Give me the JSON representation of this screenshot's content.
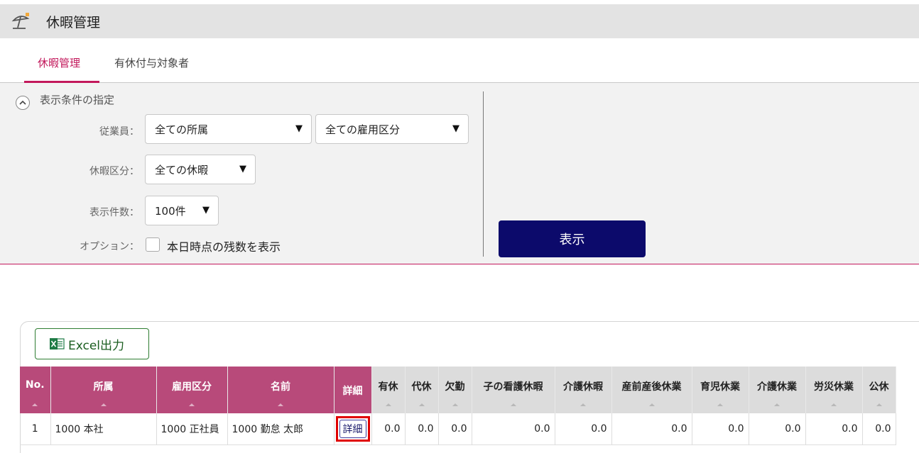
{
  "app": {
    "title": "休暇管理",
    "icon": "beach-umbrella-icon"
  },
  "tabs": [
    {
      "label": "休暇管理",
      "active": true
    },
    {
      "label": "有休付与対象者",
      "active": false
    }
  ],
  "filter": {
    "heading": "表示条件の指定",
    "employee_label": "従業員：",
    "department_select": "全ての所属",
    "employment_select": "全ての雇用区分",
    "leave_type_label": "休暇区分：",
    "leave_type_select": "全ての休暇",
    "page_size_label": "表示件数：",
    "page_size_select": "100件",
    "option_label": "オプション：",
    "option_checkbox_label": "本日時点の残数を表示",
    "option_checked": false,
    "show_button": "表示"
  },
  "results": {
    "excel_button": "Excel出力",
    "columns": [
      "No.",
      "所属",
      "雇用区分",
      "名前",
      "詳細",
      "有休",
      "代休",
      "欠勤",
      "子の看護休暇",
      "介護休暇",
      "産前産後休業",
      "育児休業",
      "介護休業",
      "労災休業",
      "公休"
    ],
    "rows": [
      {
        "no": "1",
        "department": "1000 本社",
        "employment": "1000 正社員",
        "name": "1000 勤怠 太郎",
        "detail_button": "詳細",
        "values": [
          "0.0",
          "0.0",
          "0.0",
          "0.0",
          "0.0",
          "0.0",
          "0.0",
          "0.0",
          "0.0",
          "0.0"
        ]
      }
    ]
  },
  "colors": {
    "accent": "#c2185b",
    "header_pink": "#b84a7a",
    "primary_button": "#0c0a6b",
    "excel_green": "#2e7d32",
    "highlight": "#e00000"
  }
}
